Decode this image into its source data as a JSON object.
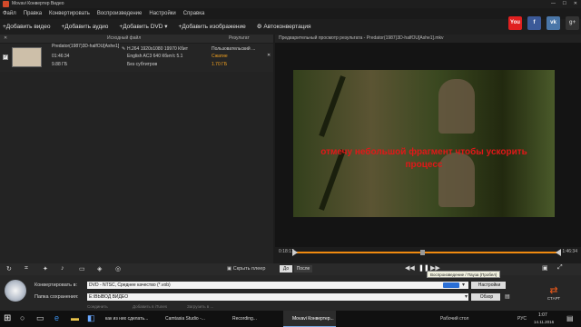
{
  "window": {
    "title": "Movavi Конвертер Видео"
  },
  "menu": [
    "Файл",
    "Правка",
    "Конвертировать",
    "Воспроизведение",
    "Настройки",
    "Справка"
  ],
  "toolbar": {
    "add_video": "Добавить видео",
    "add_audio": "Добавить аудио",
    "add_dvd": "Добавить DVD",
    "add_image": "Добавить изображение",
    "autoconvert": "Автоконвертация"
  },
  "social": [
    {
      "icon": "youtube-icon",
      "text": "You",
      "color": "#e02020"
    },
    {
      "icon": "facebook-icon",
      "text": "f",
      "color": "#3b5998"
    },
    {
      "icon": "vk-icon",
      "text": "vk",
      "color": "#4a76a8"
    }
  ],
  "list_header": {
    "source": "Исходный файл",
    "result": "Результат"
  },
  "file": {
    "name": "Predator(1987)3D-halfOU[Ashe1]",
    "duration": "01:46:34",
    "size": "9.88 ГБ",
    "video": "H.264 1920x1080 19970 Кбит",
    "audio": "English AC3 640 Кбит/с 5.1",
    "subs": "Без субтитров",
    "result_profile": "Пользовательский ...",
    "result_status": "Сжатие",
    "result_size": "1.70 ГБ"
  },
  "preview": {
    "title": "Предварительный просмотр результата - Predator(1987)3D-halfOU[Ashe1].mkv",
    "overlay_line1": "отмечу небольшой фрагмент чтобы ускорить",
    "overlay_line2": "процесс",
    "time_start": "0:18:17",
    "time_end": "1:46:34"
  },
  "controls": {
    "split_label": "Скрыть плеер",
    "before": "До",
    "after": "После",
    "tooltip": "Воспроизведение / Пауза (Пробел)"
  },
  "bottom": {
    "convert_to_label": "Конвертировать в:",
    "convert_to_value": "DVD - NTSC, Среднее качество (*.vob)",
    "settings_button": "Настройки",
    "save_label": "Папка сохранения:",
    "save_value": "E:\\ВЫВОД ВИДЕО",
    "browse_button": "Обзор",
    "opt1": "Соединить",
    "opt2": "Добавить в iTunes",
    "opt3": "Загрузить в ...",
    "start": "СТАРТ"
  },
  "taskbar": {
    "items": [
      "как из них сделать...",
      "Camtasia Studio -...",
      "Recording...",
      "Movavi Конвертер..."
    ],
    "desktop": "Рабочий стол",
    "lang": "РУС",
    "time": "1:07",
    "date": "14.11.2016"
  }
}
